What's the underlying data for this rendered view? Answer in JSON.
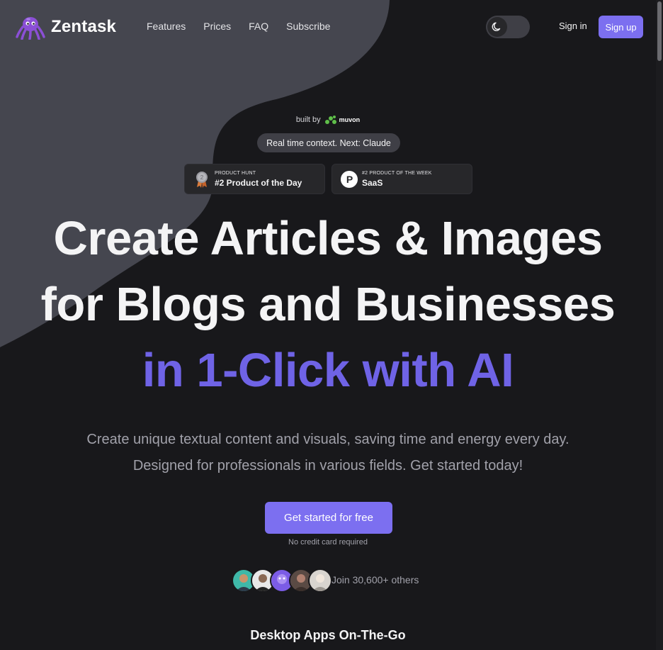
{
  "brand": {
    "name": "Zentask",
    "accent": "#7c6ff0"
  },
  "nav": {
    "items": [
      "Features",
      "Prices",
      "FAQ",
      "Subscribe"
    ]
  },
  "header": {
    "theme_toggle_icon": "moon-icon",
    "signin_label": "Sign in",
    "signup_label": "Sign up"
  },
  "hero": {
    "built_by": "built by",
    "built_by_brand": "muvon",
    "pill": "Real time context. Next: Claude",
    "badges": [
      {
        "small": "PRODUCT HUNT",
        "big": "#2 Product of the Day",
        "icon": "medal-icon",
        "medal_number": "2"
      },
      {
        "small": "#2 PRODUCT OF THE WEEK",
        "big": "SaaS",
        "icon": "product-hunt-icon",
        "letter": "P"
      }
    ],
    "headline_line1": "Create Articles & Images",
    "headline_line2": "for Blogs and Businesses",
    "headline_line3": "in 1-Click with AI",
    "sub_line1": "Create unique textual content and visuals, saving time and energy every day.",
    "sub_line2": "Designed for professionals in various fields. Get started today!",
    "cta_label": "Get started for free",
    "cta_note": "No credit card required",
    "join_text": "Join 30,600+ others",
    "next_section_title": "Desktop Apps On-The-Go"
  }
}
